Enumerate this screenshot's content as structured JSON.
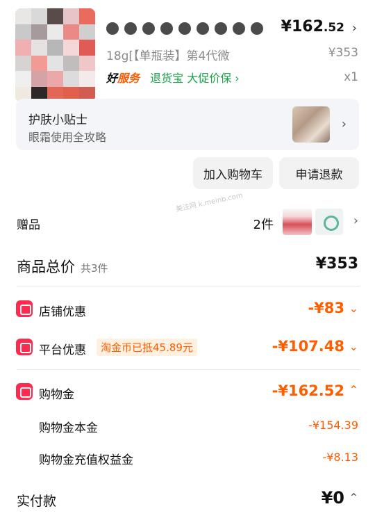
{
  "product": {
    "title_redacted": "",
    "price_main": "¥162",
    "price_decimal": ".52",
    "spec": "18g[【单瓶装】第4代微",
    "original_price": "¥353",
    "tag_service": "好服务",
    "tag_service_a": "好",
    "tag_service_b": "服务",
    "tag_guarantee": "退货宝 大促价保 ›",
    "quantity": "x1"
  },
  "tips": {
    "title": "护肤小贴士",
    "subtitle": "眼霜使用全攻略"
  },
  "actions": {
    "add_cart": "加入购物车",
    "refund": "申请退款"
  },
  "watermark": "美注网 k.meinb.com",
  "gift": {
    "label": "赠品",
    "count": "2件"
  },
  "totals": {
    "label": "商品总价",
    "count": "共3件",
    "value": "¥353"
  },
  "discounts": {
    "store": {
      "label": "店铺优惠",
      "value": "-¥83"
    },
    "platform": {
      "label": "平台优惠",
      "tag": "淘金币已抵45.89元",
      "value": "-¥107.48"
    },
    "shopping_gold": {
      "label": "购物金",
      "value": "-¥162.52",
      "principal_label": "购物金本金",
      "principal_value": "-¥154.39",
      "bonus_label": "购物金充值权益金",
      "bonus_value": "-¥8.13"
    }
  },
  "payment": {
    "label": "实付款",
    "value": "¥0"
  },
  "colors": {
    "accent_orange": "#ff5d00",
    "icon_red": "#ff2a4d",
    "tag_green": "#1aa34a"
  }
}
